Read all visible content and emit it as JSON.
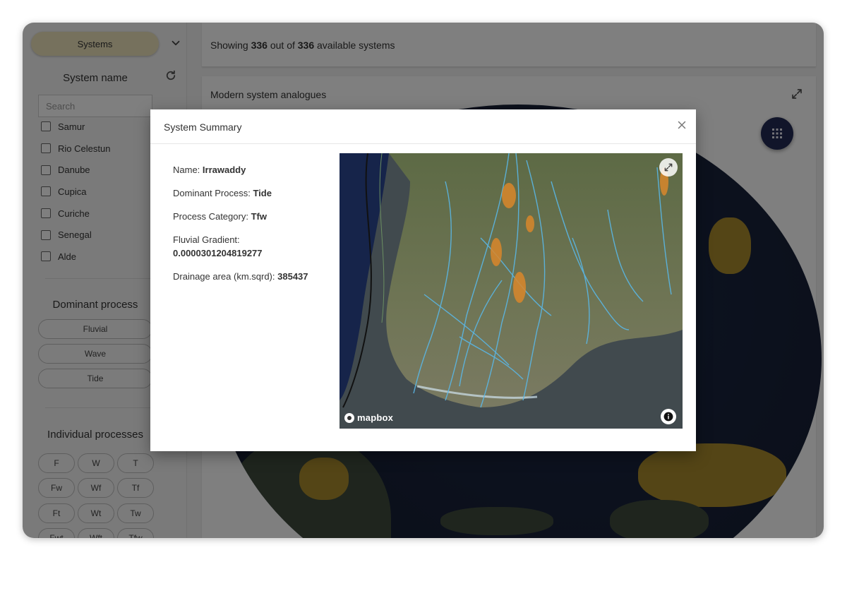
{
  "sidebar": {
    "systems_label": "Systems",
    "system_name_title": "System name",
    "search_placeholder": "Search",
    "systems": [
      "Samur",
      "Rio Celestun",
      "Danube",
      "Cupica",
      "Curiche",
      "Senegal",
      "Alde"
    ],
    "dominant_process_title": "Dominant process",
    "dominant_processes": [
      "Fluvial",
      "Wave",
      "Tide"
    ],
    "individual_processes_title": "Individual processes",
    "individual_processes": [
      "F",
      "W",
      "T",
      "Fw",
      "Wf",
      "Tf",
      "Ft",
      "Wt",
      "Tw",
      "Fwt",
      "Wft",
      "Tfw"
    ]
  },
  "main": {
    "count_prefix": "Showing",
    "count_shown": "336",
    "count_middle": "out of",
    "count_total": "336",
    "count_suffix": "available systems",
    "analogues_title": "Modern system analogues"
  },
  "modal": {
    "title": "System Summary",
    "fields": [
      {
        "label": "Name:",
        "value": "Irrawaddy"
      },
      {
        "label": "Dominant Process:",
        "value": "Tide"
      },
      {
        "label": "Process Category:",
        "value": "Tfw"
      },
      {
        "label": "Fluvial Gradient:",
        "value": "0.0000301204819277"
      },
      {
        "label": "Drainage area (km.sqrd):",
        "value": "385437"
      }
    ],
    "map_attribution": "mapbox"
  },
  "colors": {
    "systems_button": "#ede2bb",
    "fab": "#232b55",
    "globe_ocean": "#172036"
  }
}
